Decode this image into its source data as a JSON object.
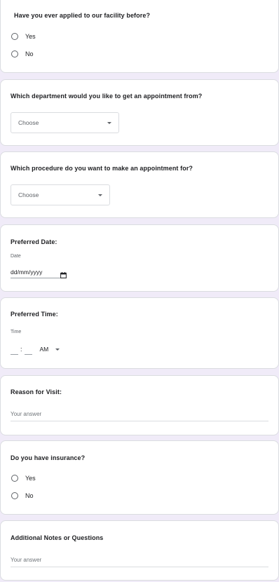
{
  "q1": {
    "title": "Have you ever applied to our facility before?",
    "options": [
      "Yes",
      "No"
    ]
  },
  "q2": {
    "title": "Which department would you like to get an appointment from?",
    "placeholder": "Choose"
  },
  "q3": {
    "title": "Which procedure do you want to make an appointment for?",
    "placeholder": "Choose"
  },
  "q4": {
    "title": "Preferred Date:",
    "label": "Date",
    "value": "dd/mm/yyyy"
  },
  "q5": {
    "title": "Preferred Time:",
    "label": "Time",
    "colon": ":",
    "ampm": "AM"
  },
  "q6": {
    "title": "Reason for Visit:",
    "placeholder": "Your answer"
  },
  "q7": {
    "title": "Do you have insurance?",
    "options": [
      "Yes",
      "No"
    ]
  },
  "q8": {
    "title": "Additional Notes or Questions",
    "placeholder": "Your answer"
  },
  "icons": {
    "date": "calendar-icon",
    "dropdown": "dropdown-arrow-icon"
  }
}
